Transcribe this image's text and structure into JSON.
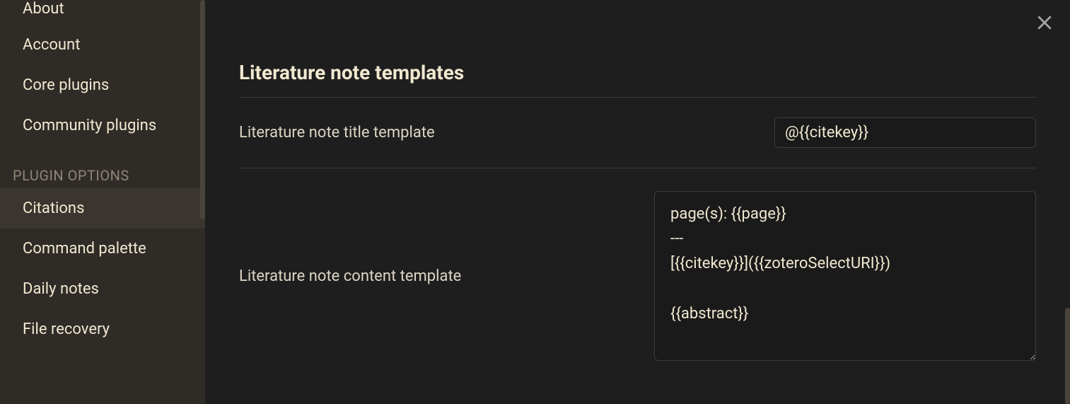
{
  "sidebar": {
    "items_top": [
      {
        "label": "About"
      },
      {
        "label": "Account"
      },
      {
        "label": "Core plugins"
      },
      {
        "label": "Community plugins"
      }
    ],
    "section_header": "PLUGIN OPTIONS",
    "items_plugins": [
      {
        "label": "Citations",
        "active": true
      },
      {
        "label": "Command palette"
      },
      {
        "label": "Daily notes"
      },
      {
        "label": "File recovery"
      }
    ]
  },
  "main": {
    "section_title": "Literature note templates",
    "title_template": {
      "label": "Literature note title template",
      "value": "@{{citekey}}"
    },
    "content_template": {
      "label": "Literature note content template",
      "value": "page(s): {{page}}\n---\n[{{citekey}}]({{zoteroSelectURI}})\n\n{{abstract}}"
    }
  }
}
